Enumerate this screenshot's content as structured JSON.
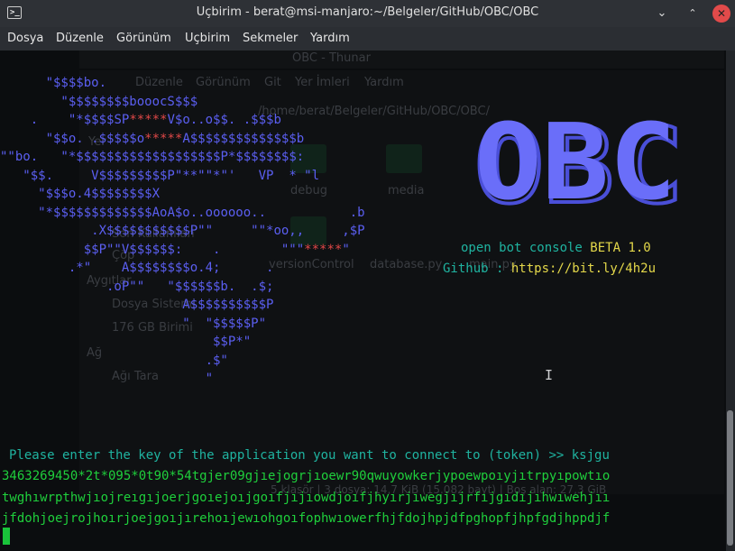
{
  "window": {
    "title": "Uçbirim - berat@msi-manjaro:~/Belgeler/GitHub/OBC/OBC",
    "icon": "terminal-icon",
    "buttons": {
      "minimize": "⌄",
      "maximize": "⌃",
      "close": "✕"
    }
  },
  "menu": [
    "Dosya",
    "Düzenle",
    "Görünüm",
    "Uçbirim",
    "Sekmeler",
    "Yardım"
  ],
  "ghost": {
    "title": "OBC - Thunar",
    "menu": [
      "Düzenle",
      "Görünüm",
      "Git",
      "Yer İmleri",
      "Yardım"
    ],
    "path": "/home/berat/Belgeler/GitHub/OBC/OBC/",
    "side_places": "Yer",
    "side_recent": "Son Kullanılan",
    "side_trash": "Çöp",
    "side_devices": "Aygıtlar",
    "side_fs": "Dosya Sistemi",
    "side_disk": "176 GB Birimi",
    "side_network": "Ağ",
    "side_browse": "Ağı Tara",
    "files": [
      "debug",
      "media",
      "versionControl",
      "database.py",
      "main.py"
    ],
    "status": "5 klasör  |  3 dosya: 14,7 KiB (15.082 bayt)  |  Boş alan: 27,3 GiB"
  },
  "terminal": {
    "art": [
      "      \"$$$$bo.",
      "        \"$$$$$$$$booocS$$$",
      "    .    \"*$$$$SP*****V$o..o$$. .$$$b",
      "      \"$$o. .$$$$$o*****A$$$$$$$$$$$$$$b",
      "\"\"bo.   \"*$$$$$$$$$$$$$$$$$$$P*$$$$$$$$:",
      "   \"$$.     V$$$$$$$$$P\"**\"\"*\"'   VP  * \"l",
      "     \"$$$o.4$$$$$$$$X",
      "     \"*$$$$$$$$$$$$$AoA$o..oooooo..           .b",
      "            .X$$$$$$$$$$$P\"\"     \"\"*oo,,     ,$P",
      "           $$P\"\"V$$$$$$:    .        \"\"\"*****\"",
      "         .*\"    A$$$$$$$$o.4;      .",
      "              .oP\"\"   \"$$$$$$b.  .$;",
      "                        A$$$$$$$$$$P",
      "                        \"  \"$$$$$P\"",
      "                            $$P*\"",
      "                           .$\"",
      "                           \""
    ],
    "banner": {
      "logo": "OBC",
      "name_prefix": "open bot console",
      "name_version": "BETA 1.0",
      "github_label": "Github : ",
      "github_url": "https://bit.ly/4h2u"
    },
    "prompt": "Please enter the key of the application you want to connect to (token) >> ksjgu",
    "input_lines": [
      "3463269450*2t*095*0t90*54tgjer09gjıejogrjıoewr90qwuyowkerjypoewpoıyjıtrpyıpowtıo",
      "twghıwrpthwjıojreıgıjoerjgoıejoıjgoıfjıjıowdjoıfjhyırjıwegjıjrfıjgıdıjıhwıwehjıı",
      "jfdohjoejrojhoırjoejgoıjırehoıjewıohgoıfophwıowerfhjfdojhpjdfpghopfjhpfgdjhppdjf"
    ]
  }
}
